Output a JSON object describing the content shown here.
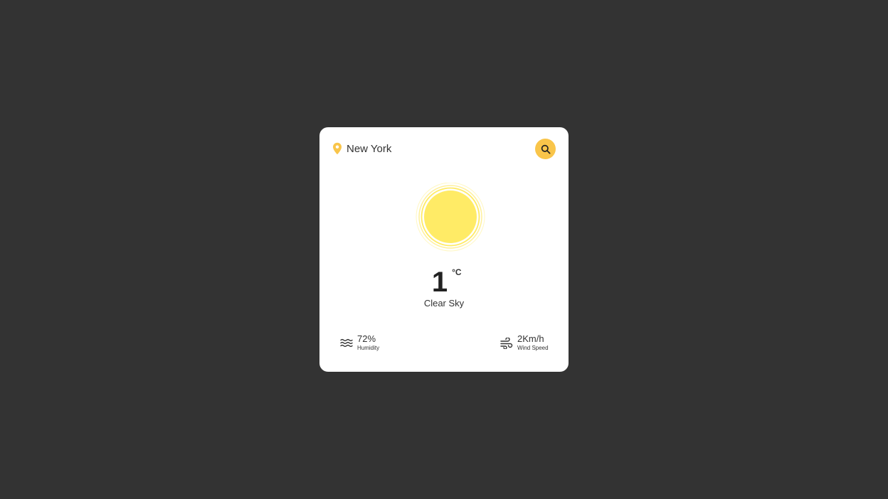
{
  "location": {
    "city": "New York",
    "icon": "map-pin-icon",
    "icon_color": "#F9C54A"
  },
  "search": {
    "icon": "search-icon",
    "button_color": "#F9C54A"
  },
  "weather": {
    "icon": "sun-icon",
    "sun_color": "#FFEB66",
    "temperature": "1",
    "unit": "°C",
    "condition": "Clear Sky"
  },
  "stats": {
    "humidity": {
      "icon": "waves-icon",
      "value": "72%",
      "label": "Humidity"
    },
    "wind": {
      "icon": "wind-icon",
      "value": "2Km/h",
      "label": "Wind Speed"
    }
  },
  "colors": {
    "background": "#333333",
    "card": "#FFFFFF",
    "accent": "#F9C54A"
  }
}
